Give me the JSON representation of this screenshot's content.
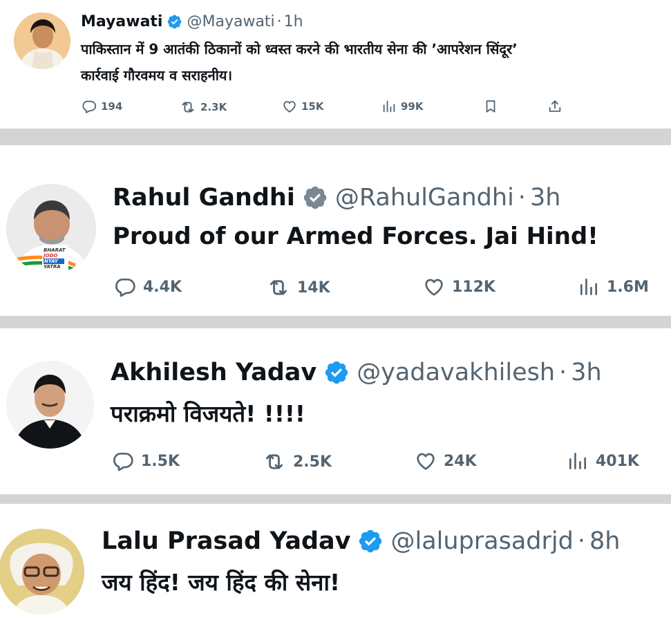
{
  "colors": {
    "verified": "#1d9bf0",
    "muted": "#536471",
    "text": "#0f1419"
  },
  "tweets": [
    {
      "name": "Mayawati",
      "handle": "@Mayawati",
      "time": "1h",
      "text_lines": [
        "पाकिस्तान में 9 आतंकी ठिकानों को ध्वस्त करने की भारतीय सेना की ’आपरेशन सिंदूर’",
        "कार्रवाई गौरवमय व सराहनीय।"
      ],
      "replies": "194",
      "reposts": "2.3K",
      "likes": "15K",
      "views": "99K",
      "avatar_icon": "user-avatar"
    },
    {
      "name": "Rahul Gandhi",
      "handle": "@RahulGandhi",
      "time": "3h",
      "text_lines": [
        "Proud of our Armed Forces. Jai Hind!"
      ],
      "replies": "4.4K",
      "reposts": "14K",
      "likes": "112K",
      "views": "1.6M",
      "avatar_badge": {
        "l1": "BHARAT",
        "l2": "JODO",
        "l3": "NYAY",
        "l4": "YATRA"
      },
      "avatar_icon": "user-avatar"
    },
    {
      "name": "Akhilesh Yadav",
      "handle": "@yadavakhilesh",
      "time": "3h",
      "text_lines": [
        "पराक्रमो विजयते! !!!!"
      ],
      "replies": "1.5K",
      "reposts": "2.5K",
      "likes": "24K",
      "views": "401K",
      "avatar_icon": "user-avatar"
    },
    {
      "name": "Lalu Prasad Yadav",
      "handle": "@laluprasadrjd",
      "time": "8h",
      "text_lines": [
        "जय हिंद! जय हिंद की सेना!"
      ],
      "avatar_icon": "user-avatar"
    }
  ]
}
